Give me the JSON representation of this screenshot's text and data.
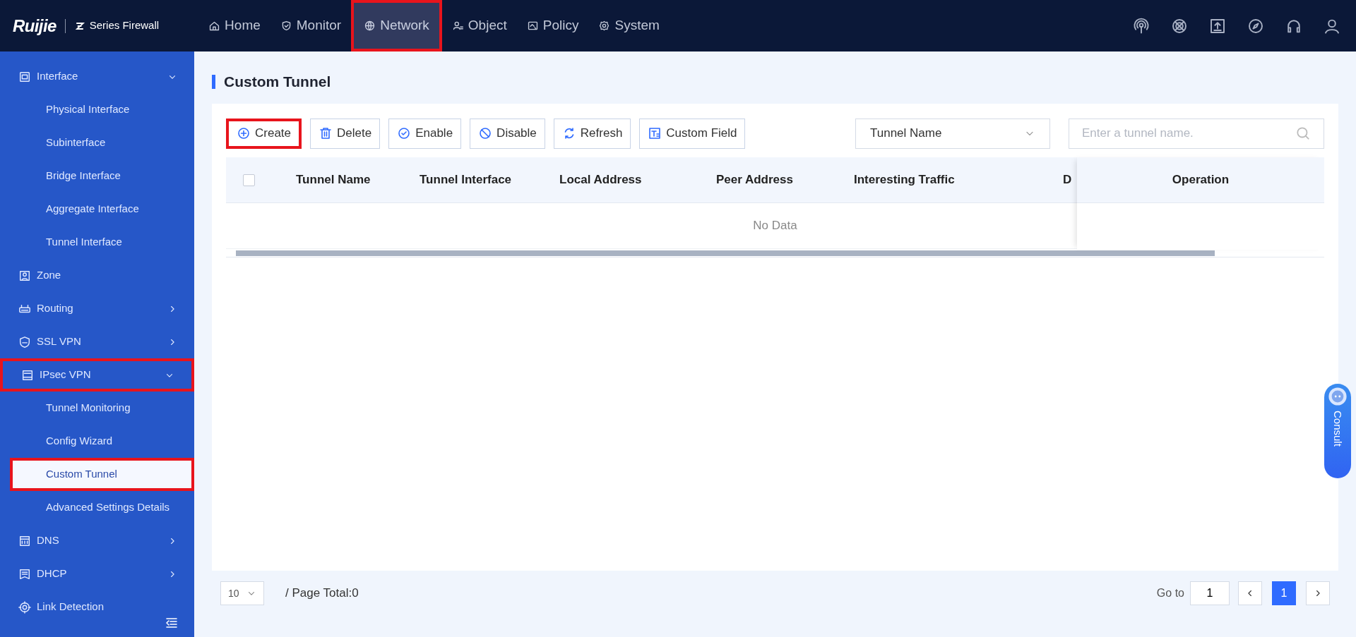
{
  "header": {
    "logo": "Ruijie",
    "product": "Series Firewall",
    "nav": [
      {
        "label": "Home",
        "selected": false,
        "highlighted": false
      },
      {
        "label": "Monitor",
        "selected": false,
        "highlighted": false
      },
      {
        "label": "Network",
        "selected": true,
        "highlighted": true
      },
      {
        "label": "Object",
        "selected": false,
        "highlighted": false
      },
      {
        "label": "Policy",
        "selected": false,
        "highlighted": false
      },
      {
        "label": "System",
        "selected": false,
        "highlighted": false
      }
    ]
  },
  "sidebar": {
    "items": [
      {
        "label": "Interface",
        "expanded": true,
        "highlighted": false,
        "children": [
          {
            "label": "Physical Interface",
            "selected": false,
            "highlighted": false
          },
          {
            "label": "Subinterface",
            "selected": false,
            "highlighted": false
          },
          {
            "label": "Bridge Interface",
            "selected": false,
            "highlighted": false
          },
          {
            "label": "Aggregate Interface",
            "selected": false,
            "highlighted": false
          },
          {
            "label": "Tunnel Interface",
            "selected": false,
            "highlighted": false
          }
        ]
      },
      {
        "label": "Zone",
        "expanded": false,
        "has_children": false,
        "highlighted": false
      },
      {
        "label": "Routing",
        "expanded": false,
        "has_children": true,
        "highlighted": false
      },
      {
        "label": "SSL VPN",
        "expanded": false,
        "has_children": true,
        "highlighted": false
      },
      {
        "label": "IPsec VPN",
        "expanded": true,
        "highlighted": true,
        "children": [
          {
            "label": "Tunnel Monitoring",
            "selected": false,
            "highlighted": false
          },
          {
            "label": "Config Wizard",
            "selected": false,
            "highlighted": false
          },
          {
            "label": "Custom Tunnel",
            "selected": true,
            "highlighted": true
          },
          {
            "label": "Advanced Settings Details",
            "selected": false,
            "highlighted": false
          }
        ]
      },
      {
        "label": "DNS",
        "expanded": false,
        "has_children": true,
        "highlighted": false
      },
      {
        "label": "DHCP",
        "expanded": false,
        "has_children": true,
        "highlighted": false
      },
      {
        "label": "Link Detection",
        "expanded": false,
        "has_children": false,
        "highlighted": false
      }
    ]
  },
  "page": {
    "title": "Custom Tunnel",
    "toolbar": [
      {
        "label": "Create",
        "highlighted": true
      },
      {
        "label": "Delete",
        "highlighted": false
      },
      {
        "label": "Enable",
        "highlighted": false
      },
      {
        "label": "Disable",
        "highlighted": false
      },
      {
        "label": "Refresh",
        "highlighted": false
      },
      {
        "label": "Custom Field",
        "highlighted": false
      }
    ],
    "filter": {
      "value": "Tunnel Name"
    },
    "search": {
      "placeholder": "Enter a tunnel name."
    },
    "table": {
      "select_all": {
        "checked": false
      },
      "columns": [
        "Tunnel Name",
        "Tunnel Interface",
        "Local Address",
        "Peer Address",
        "Interesting Traffic",
        "D"
      ],
      "fixed_column": "Operation",
      "empty_text": "No Data"
    },
    "pagination": {
      "page_size": "10",
      "total": "/ Page Total:0",
      "goto_label": "Go to",
      "goto_value": "1",
      "pages": [
        {
          "label": "1",
          "selected": true
        }
      ]
    }
  },
  "consult": {
    "label": "Consult"
  }
}
